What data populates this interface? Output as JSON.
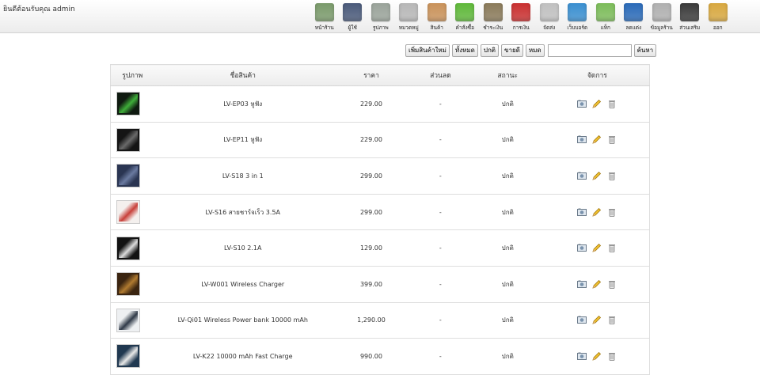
{
  "header": {
    "welcome": "ยินดีต้อนรับคุณ admin"
  },
  "menu": [
    {
      "label": "หน้าร้าน",
      "icon": "storefront-icon",
      "color": "#7a9a6b"
    },
    {
      "label": "ผู้ใช้",
      "icon": "user-icon",
      "color": "#4a5a7a"
    },
    {
      "label": "รูปภาพ",
      "icon": "images-icon",
      "color": "#9aa39a"
    },
    {
      "label": "หมวดหมู่",
      "icon": "category-box-icon",
      "color": "#b7b7b7"
    },
    {
      "label": "สินค้า",
      "icon": "product-box-icon",
      "color": "#c9925a"
    },
    {
      "label": "คำสั่งซื้อ",
      "icon": "order-box-icon",
      "color": "#5fb83a"
    },
    {
      "label": "ชำระเงิน",
      "icon": "payment-icon",
      "color": "#8a7a5a"
    },
    {
      "label": "การเงิน",
      "icon": "finance-icon",
      "color": "#c93030"
    },
    {
      "label": "จัดส่ง",
      "icon": "shipping-icon",
      "color": "#c0c0c0"
    },
    {
      "label": "เว็บบอร์ด",
      "icon": "webboard-icon",
      "color": "#3a8fd0"
    },
    {
      "label": "แท็ก",
      "icon": "tag-icon",
      "color": "#7cbc5a"
    },
    {
      "label": "ลดแต่ง",
      "icon": "decorate-icon",
      "color": "#2a6ab8"
    },
    {
      "label": "ข้อมูลร้าน",
      "icon": "store-info-icon",
      "color": "#b0b0b0"
    },
    {
      "label": "ส่วนเสริม",
      "icon": "addon-icon",
      "color": "#3a3a3a"
    },
    {
      "label": "ออก",
      "icon": "logout-lock-icon",
      "color": "#d8a840"
    }
  ],
  "toolbar": {
    "add_product": "เพิ่มสินค้าใหม่",
    "filter_all": "ทั้งหมด",
    "filter_normal": "ปกติ",
    "filter_bestseller": "ขายดี",
    "filter_soldout": "หมด",
    "search_value": "",
    "search_button": "ค้นหา"
  },
  "table": {
    "headers": {
      "image": "รูปภาพ",
      "name": "ชื่อสินค้า",
      "price": "ราคา",
      "discount": "ส่วนลด",
      "status": "สถานะ",
      "manage": "จัดการ"
    },
    "rows": [
      {
        "name": "LV-EP03 หูฟัง",
        "price": "229.00",
        "discount": "-",
        "status": "ปกติ",
        "thumb_bg": "#0f1a10",
        "thumb_fg": "#3fae3a"
      },
      {
        "name": "LV-EP11 หูฟัง",
        "price": "229.00",
        "discount": "-",
        "status": "ปกติ",
        "thumb_bg": "#151515",
        "thumb_fg": "#6a6a6a"
      },
      {
        "name": "LV-S18 3 in 1",
        "price": "299.00",
        "discount": "-",
        "status": "ปกติ",
        "thumb_bg": "#2a3552",
        "thumb_fg": "#6a7aa0"
      },
      {
        "name": "LV-S16 สายชาร์จเร็ว 3.5A",
        "price": "299.00",
        "discount": "-",
        "status": "ปกติ",
        "thumb_bg": "#f4f0ee",
        "thumb_fg": "#c8403a"
      },
      {
        "name": "LV-S10 2.1A",
        "price": "129.00",
        "discount": "-",
        "status": "ปกติ",
        "thumb_bg": "#121212",
        "thumb_fg": "#dcdcdc"
      },
      {
        "name": "LV-W001 Wireless Charger",
        "price": "399.00",
        "discount": "-",
        "status": "ปกติ",
        "thumb_bg": "#3a2410",
        "thumb_fg": "#b07a30"
      },
      {
        "name": "LV-Qi01 Wireless Power bank 10000 mAh",
        "price": "1,290.00",
        "discount": "-",
        "status": "ปกติ",
        "thumb_bg": "#eef0f2",
        "thumb_fg": "#303a48"
      },
      {
        "name": "LV-K22 10000 mAh Fast Charge",
        "price": "990.00",
        "discount": "-",
        "status": "ปกติ",
        "thumb_bg": "#203850",
        "thumb_fg": "#e8e8e8"
      }
    ]
  },
  "actions": {
    "image": "image-icon",
    "edit": "edit-pencil-icon",
    "delete": "delete-trash-icon"
  }
}
